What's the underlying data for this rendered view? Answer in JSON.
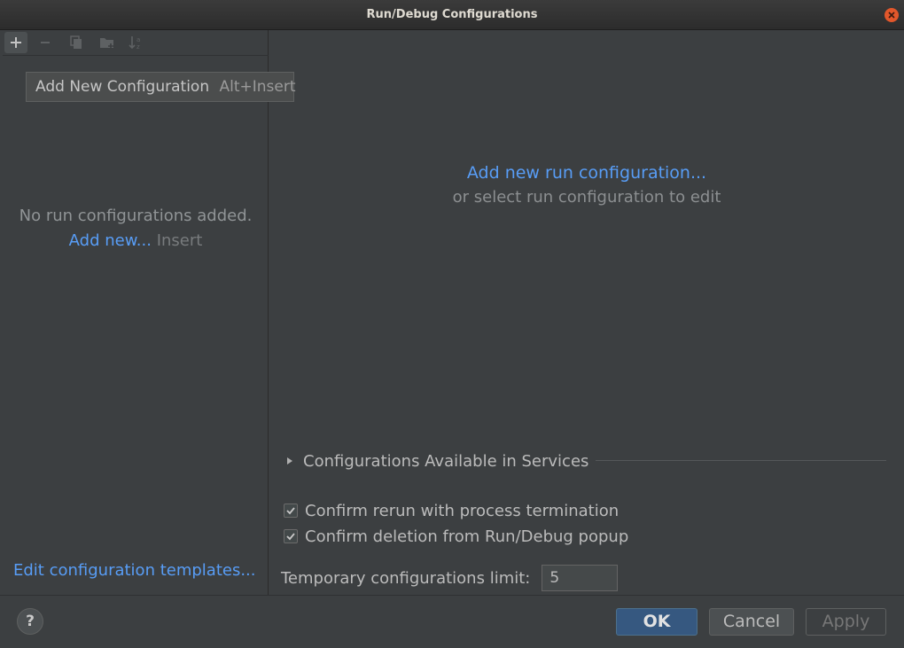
{
  "window": {
    "title": "Run/Debug Configurations"
  },
  "toolbar": {
    "buttons": [
      {
        "icon": "plus-icon",
        "state": "hovered"
      },
      {
        "icon": "minus-icon",
        "state": "disabled"
      },
      {
        "icon": "copy-icon",
        "state": "disabled"
      },
      {
        "icon": "folder-add-icon",
        "state": "disabled"
      },
      {
        "icon": "sort-icon",
        "state": "disabled"
      }
    ]
  },
  "tooltip": {
    "label": "Add New Configuration",
    "shortcut": "Alt+Insert"
  },
  "left_pane": {
    "empty_text": "No run configurations added.",
    "add_new_link": "Add new...",
    "add_new_shortcut": "Insert",
    "templates_link": "Edit configuration templates..."
  },
  "right_pane": {
    "add_link": "Add new run configuration...",
    "hint": "or select run configuration to edit",
    "services_label": "Configurations Available in Services",
    "confirm_rerun": {
      "label": "Confirm rerun with process termination",
      "checked": true
    },
    "confirm_deletion": {
      "label": "Confirm deletion from Run/Debug popup",
      "checked": true
    },
    "temp_limit": {
      "label": "Temporary configurations limit:",
      "value": "5"
    }
  },
  "buttons": {
    "help": "?",
    "ok": "OK",
    "cancel": "Cancel",
    "apply": "Apply"
  },
  "colors": {
    "background": "#3c3f41",
    "link": "#589df6",
    "ok_button": "#365880",
    "close_button": "#e2572b"
  }
}
